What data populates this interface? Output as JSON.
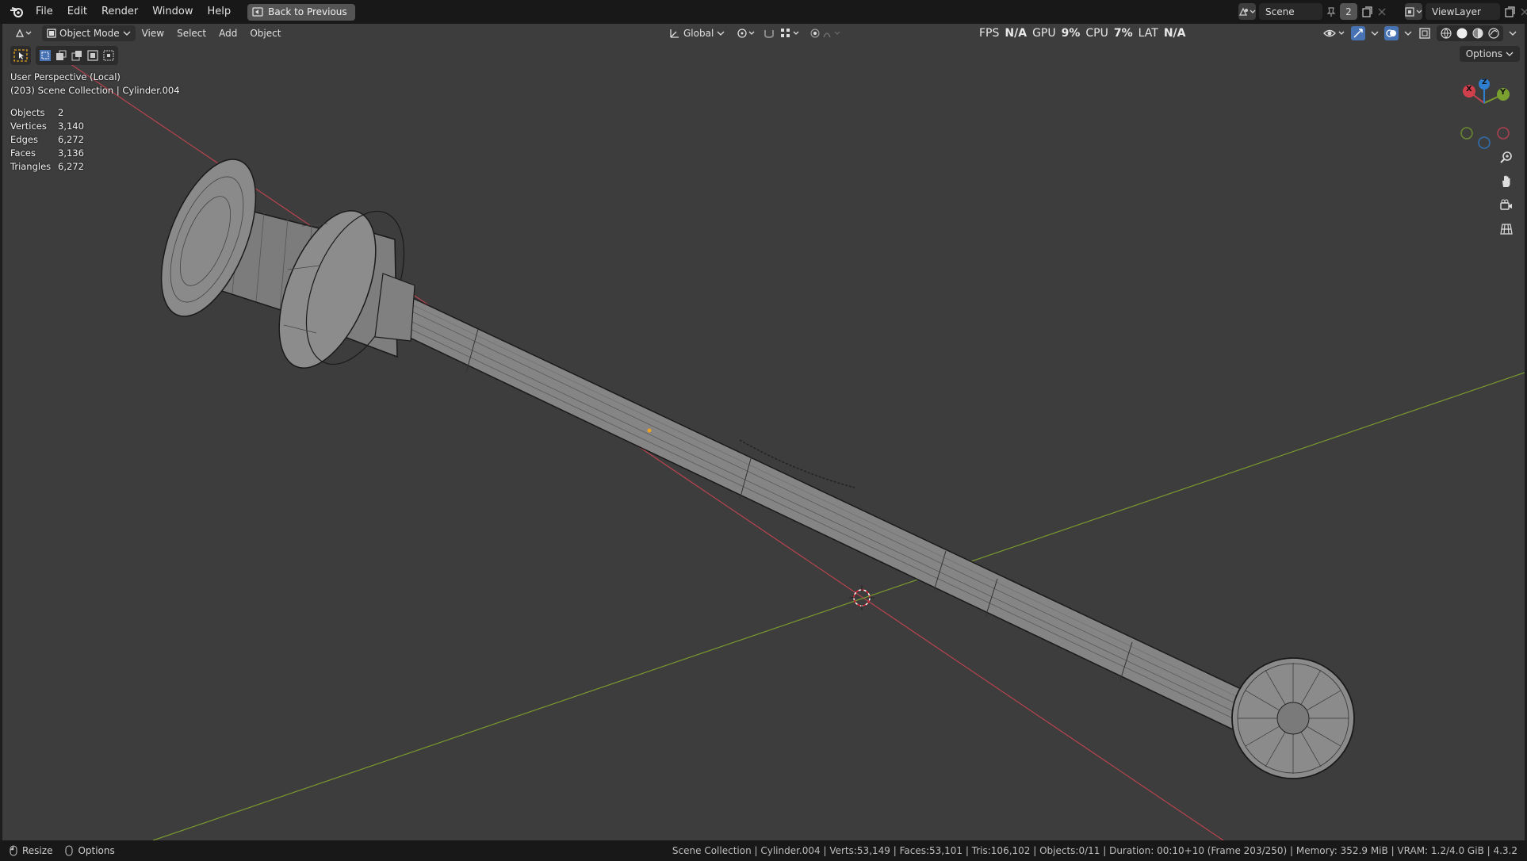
{
  "topbar": {
    "menus": [
      "File",
      "Edit",
      "Render",
      "Window",
      "Help"
    ],
    "back_button": "Back to Previous",
    "scene_name": "Scene",
    "scene_users": "2",
    "view_layer": "ViewLayer"
  },
  "viewport_header": {
    "mode": "Object Mode",
    "menus": [
      "View",
      "Select",
      "Add",
      "Object"
    ],
    "orientation": "Global",
    "options_label": "Options"
  },
  "perf": {
    "fps_label": "FPS",
    "fps_value": "N/A",
    "gpu_label": "GPU",
    "gpu_value": "9%",
    "cpu_label": "CPU",
    "cpu_value": "7%",
    "lat_label": "LAT",
    "lat_value": "N/A"
  },
  "overlay": {
    "view_name": "User Perspective (Local)",
    "collection_info": "(203) Scene Collection | Cylinder.004"
  },
  "stats": [
    {
      "label": "Objects",
      "value": "2"
    },
    {
      "label": "Vertices",
      "value": "3,140"
    },
    {
      "label": "Edges",
      "value": "6,272"
    },
    {
      "label": "Faces",
      "value": "3,136"
    },
    {
      "label": "Triangles",
      "value": "6,272"
    }
  ],
  "gizmo": {
    "x": "X",
    "y": "Y",
    "z": "Z"
  },
  "statusbar": {
    "left_items": [
      "Resize",
      "Options"
    ],
    "info": "Scene Collection | Cylinder.004 | Verts:53,149 | Faces:53,101 | Tris:106,102 | Objects:0/11 | Duration: 00:10+10 (Frame 203/250) | Memory: 352.9 MiB | VRAM: 1.2/4.0 GiB | 4.3.2"
  },
  "colors": {
    "x_axis": "#c0434f",
    "y_axis": "#7a9a2f",
    "z_axis": "#2f7fd0",
    "viewport_bg": "#3d3d3d"
  },
  "icons": [
    "blender-logo-icon",
    "editor-type-icon",
    "object-mode-icon",
    "orientation-icon",
    "snap-icon",
    "proportional-icon",
    "visibility-icon",
    "gizmo-icon",
    "overlay-icon",
    "xray-icon",
    "wireframe-shading-icon",
    "solid-shading-icon",
    "material-shading-icon",
    "rendered-shading-icon",
    "zoom-icon",
    "hand-icon",
    "camera-icon",
    "grid-icon"
  ]
}
